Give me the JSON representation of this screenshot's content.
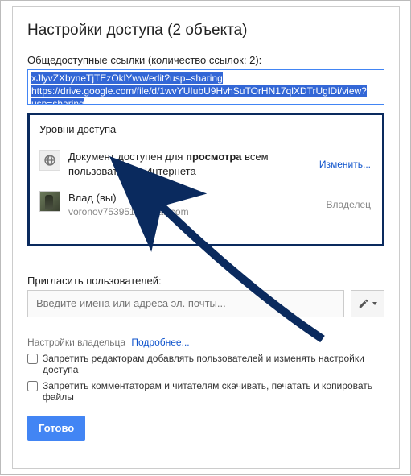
{
  "title": "Настройки доступа (2 объекта)",
  "links_section": {
    "label": "Общедоступные ссылки (количество ссылок: 2):",
    "text1": "xJlyvZXbyneTjTEzOklYww/edit?usp=sharing",
    "text2": "https://drive.google.com/file/d/1wvYUIubU9HvhSuTOrHN17qlXDTrUglDi/view?",
    "text3": "usp=sharing"
  },
  "access": {
    "title": "Уровни доступа",
    "public": {
      "prefix": "Документ доступен для ",
      "bold": "просмотра",
      "suffix": " всем пользователям Интернета",
      "change_label": "Изменить..."
    },
    "owner": {
      "name": "Влад (вы)",
      "email": "voronov753951@gmail.com",
      "role": "Владелец"
    }
  },
  "invite": {
    "label": "Пригласить пользователей:",
    "placeholder": "Введите имена или адреса эл. почты..."
  },
  "owner_settings": {
    "label": "Настройки владельца",
    "more": "Подробнее...",
    "cb1": "Запретить редакторам добавлять пользователей и изменять настройки доступа",
    "cb2": "Запретить комментаторам и читателям скачивать, печатать и копировать файлы"
  },
  "done": "Готово"
}
